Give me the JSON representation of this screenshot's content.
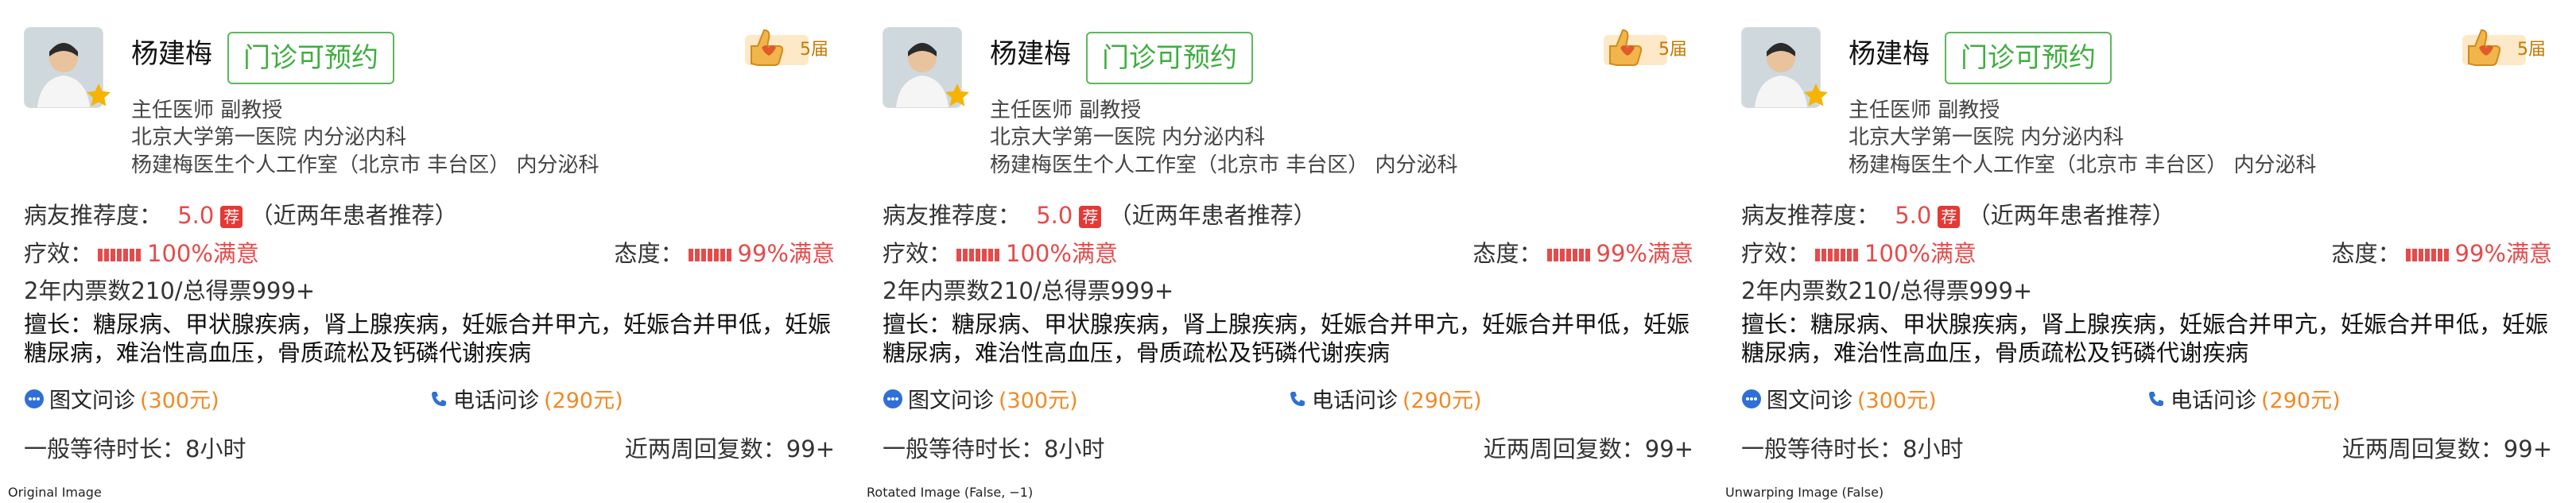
{
  "panels": [
    {
      "name": "杨建梅",
      "appointment": "门诊可预约",
      "title": "主任医师 副教授",
      "hospital": "北京大学第一医院 内分泌内科",
      "studio": "杨建梅医生个人工作室（北京市 丰台区） 内分泌科",
      "sessions": "5届",
      "recommend_label": "病友推荐度：",
      "recommend_score": "5.0",
      "recommend_badge": "荐",
      "recommend_note": "（近两年患者推荐）",
      "effect_label": "疗效：",
      "effect_value": "100%满意",
      "attitude_label": "态度：",
      "attitude_value": "99%满意",
      "votes": "2年内票数210/总得票999+",
      "specialty": "擅长：糖尿病、甲状腺疾病，肾上腺疾病，妊娠合并甲亢，妊娠合并甲低，妊娠糖尿病，难治性高血压，骨质疏松及钙磷代谢疾病",
      "text_consult_label": "图文问诊",
      "text_consult_price": "(300元)",
      "phone_consult_label": "电话问诊",
      "phone_consult_price": "(290元)",
      "wait_label": "一般等待时长：",
      "wait_value": "8小时",
      "reply_label": "近两周回复数：",
      "reply_value": "99+",
      "caption": "Original Image"
    },
    {
      "name": "杨建梅",
      "appointment": "门诊可预约",
      "title": "主任医师 副教授",
      "hospital": "北京大学第一医院 内分泌内科",
      "studio": "杨建梅医生个人工作室（北京市 丰台区） 内分泌科",
      "sessions": "5届",
      "recommend_label": "病友推荐度：",
      "recommend_score": "5.0",
      "recommend_badge": "荐",
      "recommend_note": "（近两年患者推荐）",
      "effect_label": "疗效：",
      "effect_value": "100%满意",
      "attitude_label": "态度：",
      "attitude_value": "99%满意",
      "votes": "2年内票数210/总得票999+",
      "specialty": "擅长：糖尿病、甲状腺疾病，肾上腺疾病，妊娠合并甲亢，妊娠合并甲低，妊娠糖尿病，难治性高血压，骨质疏松及钙磷代谢疾病",
      "text_consult_label": "图文问诊",
      "text_consult_price": "(300元)",
      "phone_consult_label": "电话问诊",
      "phone_consult_price": "(290元)",
      "wait_label": "一般等待时长：",
      "wait_value": "8小时",
      "reply_label": "近两周回复数：",
      "reply_value": "99+",
      "caption": "Rotated Image (False, −1)"
    },
    {
      "name": "杨建梅",
      "appointment": "门诊可预约",
      "title": "主任医师 副教授",
      "hospital": "北京大学第一医院 内分泌内科",
      "studio": "杨建梅医生个人工作室（北京市 丰台区） 内分泌科",
      "sessions": "5届",
      "recommend_label": "病友推荐度：",
      "recommend_score": "5.0",
      "recommend_badge": "荐",
      "recommend_note": "（近两年患者推荐）",
      "effect_label": "疗效：",
      "effect_value": "100%满意",
      "attitude_label": "态度：",
      "attitude_value": "99%满意",
      "votes": "2年内票数210/总得票999+",
      "specialty": "擅长：糖尿病、甲状腺疾病，肾上腺疾病，妊娠合并甲亢，妊娠合并甲低，妊娠糖尿病，难治性高血压，骨质疏松及钙磷代谢疾病",
      "text_consult_label": "图文问诊",
      "text_consult_price": "(300元)",
      "phone_consult_label": "电话问诊",
      "phone_consult_price": "(290元)",
      "wait_label": "一般等待时长：",
      "wait_value": "8小时",
      "reply_label": "近两周回复数：",
      "reply_value": "99+",
      "caption": "Unwarping Image (False)"
    }
  ],
  "colors": {
    "accent_green": "#5cb85c",
    "rating_red": "#e54b4b",
    "price_orange": "#f08a24",
    "badge_red": "#e53935"
  },
  "icons": [
    "doctor-avatar",
    "star-icon",
    "thumbs-up-icon",
    "chat-bubble-icon",
    "phone-icon"
  ]
}
